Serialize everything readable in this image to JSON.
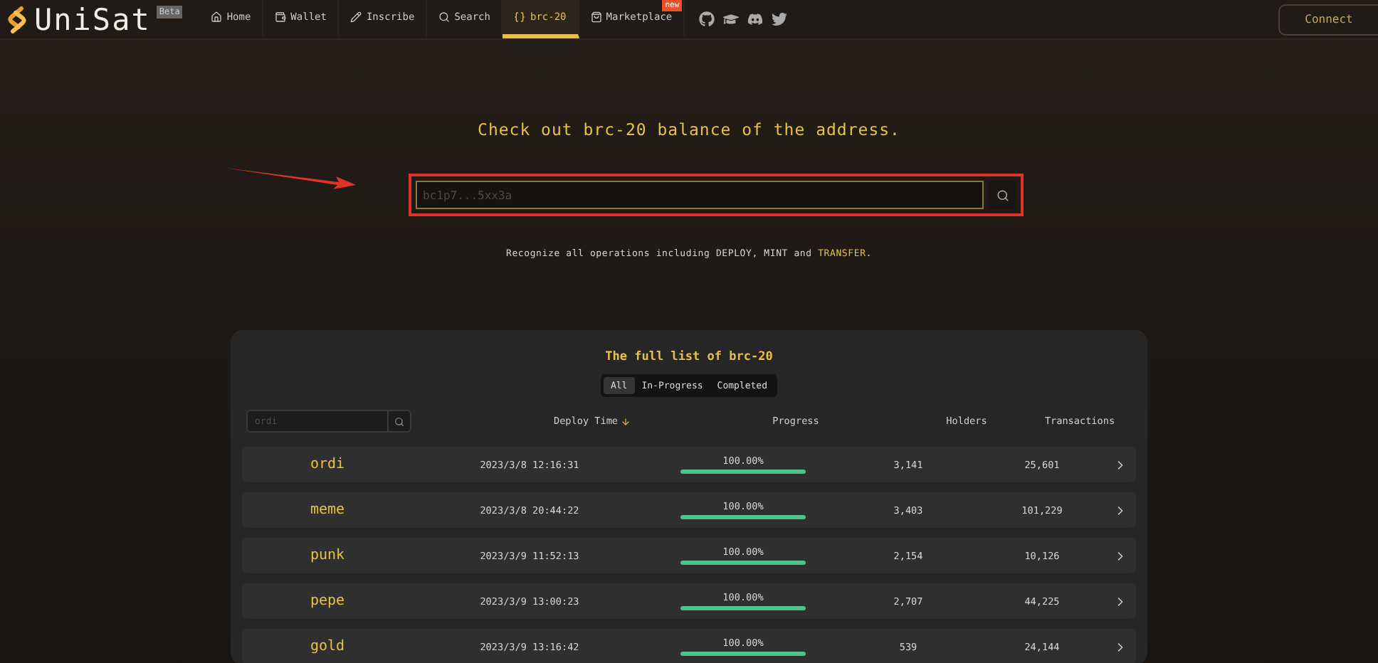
{
  "brand": {
    "name": "UniSat",
    "badge": "Beta"
  },
  "nav": [
    {
      "label": "Home",
      "selected": false
    },
    {
      "label": "Wallet",
      "selected": false
    },
    {
      "label": "Inscribe",
      "selected": false
    },
    {
      "label": "Search",
      "selected": false
    },
    {
      "label": "brc-20",
      "selected": true
    },
    {
      "label": "Marketplace",
      "selected": false,
      "badge": "new"
    }
  ],
  "connect": "Connect",
  "hero": {
    "title": "Check out brc-20 balance of the address.",
    "placeholder": "bc1p7...5xx3a",
    "note": {
      "before": "Recognize all operations including DEPLOY, MINT and ",
      "highlight": "TRANSFER",
      "after": "."
    }
  },
  "list": {
    "title": "The full list of brc-20",
    "filters": [
      {
        "label": "All",
        "selected": true
      },
      {
        "label": "In-Progress",
        "selected": false
      },
      {
        "label": "Completed",
        "selected": false
      }
    ],
    "search_placeholder": "ordi",
    "columns": [
      {
        "label": "Deploy Time",
        "sorted": true
      },
      {
        "label": "Progress",
        "sorted": false
      },
      {
        "label": "Holders",
        "sorted": false
      },
      {
        "label": "Transactions",
        "sorted": false
      }
    ],
    "rows": [
      {
        "ticker": "ordi",
        "deploy_time": "2023/3/8 12:16:31",
        "progress": "100.00%",
        "level": 1,
        "holders": "3,141",
        "transactions": "25,601"
      },
      {
        "ticker": "meme",
        "deploy_time": "2023/3/8 20:44:22",
        "progress": "100.00%",
        "level": 1,
        "holders": "3,403",
        "transactions": "101,229"
      },
      {
        "ticker": "punk",
        "deploy_time": "2023/3/9 11:52:13",
        "progress": "100.00%",
        "level": 1,
        "holders": "2,154",
        "transactions": "10,126"
      },
      {
        "ticker": "pepe",
        "deploy_time": "2023/3/9 13:00:23",
        "progress": "100.00%",
        "level": 1,
        "holders": "2,707",
        "transactions": "44,225"
      },
      {
        "ticker": "gold",
        "deploy_time": "2023/3/9 13:16:42",
        "progress": "100.00%",
        "level": 1,
        "holders": "539",
        "transactions": "24,144"
      }
    ]
  }
}
